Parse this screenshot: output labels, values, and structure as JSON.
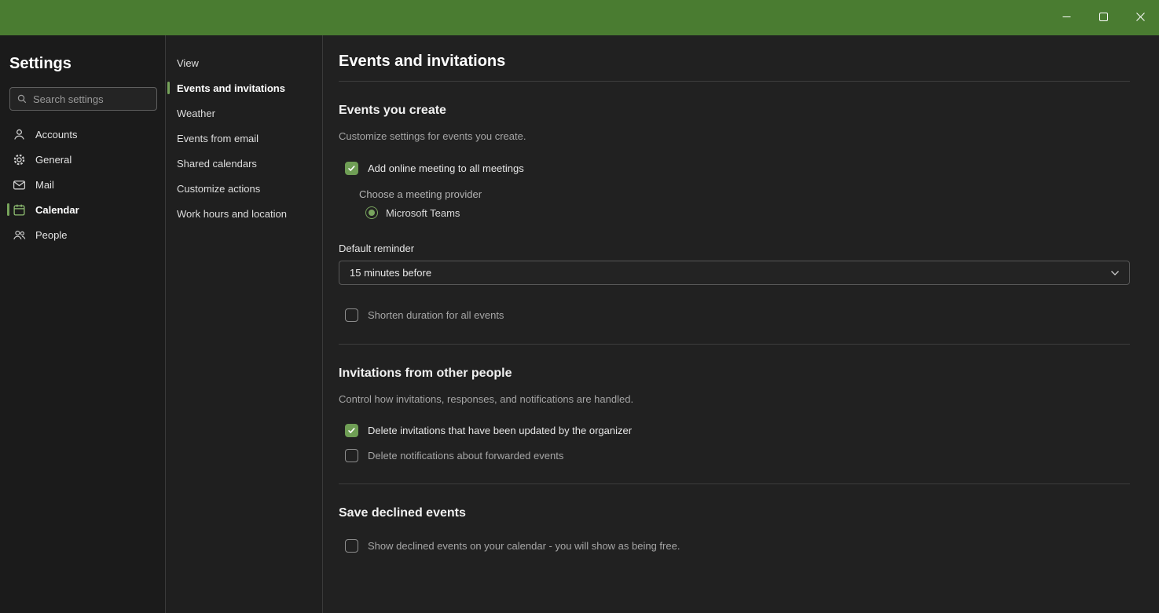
{
  "colors": {
    "titlebar_green": "#4a7c31",
    "accent_green": "#76a35a",
    "checkbox_green": "#6f9e55"
  },
  "sidebar": {
    "title": "Settings",
    "search": {
      "placeholder": "Search settings",
      "icon": "search-icon"
    },
    "items": [
      {
        "label": "Accounts",
        "icon": "person-icon",
        "selected": false
      },
      {
        "label": "General",
        "icon": "gear-icon",
        "selected": false
      },
      {
        "label": "Mail",
        "icon": "mail-icon",
        "selected": false
      },
      {
        "label": "Calendar",
        "icon": "calendar-icon",
        "selected": true
      },
      {
        "label": "People",
        "icon": "people-icon",
        "selected": false
      }
    ]
  },
  "subnav": {
    "items": [
      {
        "label": "View",
        "selected": false
      },
      {
        "label": "Events and invitations",
        "selected": true
      },
      {
        "label": "Weather",
        "selected": false
      },
      {
        "label": "Events from email",
        "selected": false
      },
      {
        "label": "Shared calendars",
        "selected": false
      },
      {
        "label": "Customize actions",
        "selected": false
      },
      {
        "label": "Work hours and location",
        "selected": false
      }
    ]
  },
  "main": {
    "title": "Events and invitations",
    "events_you_create": {
      "heading": "Events you create",
      "description": "Customize settings for events you create.",
      "add_online_meeting": {
        "label": "Add online meeting to all meetings",
        "checked": true
      },
      "provider_label": "Choose a meeting provider",
      "provider_option": {
        "label": "Microsoft Teams",
        "selected": true
      },
      "default_reminder": {
        "label": "Default reminder",
        "value": "15 minutes before"
      },
      "shorten_duration": {
        "label": "Shorten duration for all events",
        "checked": false
      }
    },
    "invitations_from_other_people": {
      "heading": "Invitations from other people",
      "description": "Control how invitations, responses, and notifications are handled.",
      "delete_updated_invitations": {
        "label": "Delete invitations that have been updated by the organizer",
        "checked": true
      },
      "delete_forwarded_notifications": {
        "label": "Delete notifications about forwarded events",
        "checked": false
      }
    },
    "save_declined_events": {
      "heading": "Save declined events",
      "show_declined": {
        "label": "Show declined events on your calendar - you will show as being free.",
        "checked": false
      }
    }
  }
}
